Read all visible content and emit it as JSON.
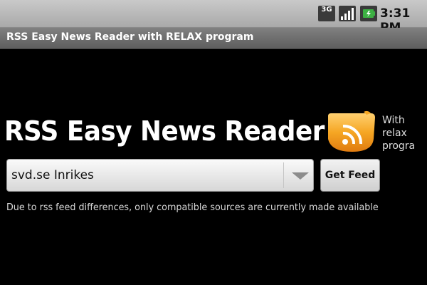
{
  "status_bar": {
    "network_label": "3G",
    "time": "3:31 PM",
    "icons": [
      "3g-icon",
      "signal-icon",
      "battery-icon"
    ]
  },
  "title_bar": {
    "title": "RSS Easy News Reader with RELAX program"
  },
  "header": {
    "title": "RSS Easy News Reader",
    "side_text": "With\nrelax\nprogra"
  },
  "feed_selector": {
    "selected": "svd.se Inrikes"
  },
  "get_feed_button": {
    "label": "Get Feed"
  },
  "note": {
    "text": "Due to rss feed differences, only compatible sources are currently made available"
  },
  "colors": {
    "background": "#000000",
    "logo_orange": "#f5a623",
    "battery_green": "#3cb043"
  }
}
